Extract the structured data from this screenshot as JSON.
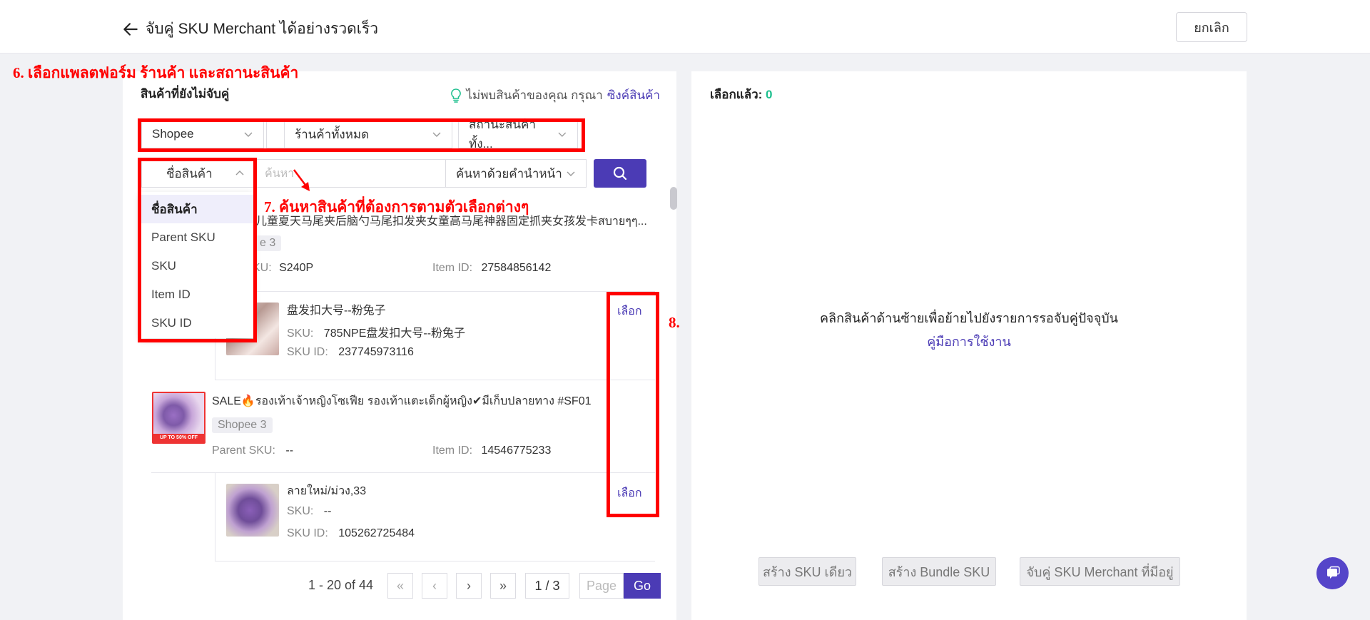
{
  "header": {
    "title": "จับคู่ SKU Merchant ได้อย่างรวดเร็ว",
    "cancel_label": "ยกเลิก"
  },
  "annotations": {
    "step6": "6. เลือกแพลตฟอร์ม ร้านค้า และสถานะสินค้า",
    "step7": "7. ค้นหาสินค้าที่ต้องการตามตัวเลือกต่างๆ",
    "step8": "8."
  },
  "left": {
    "title": "สินค้าที่ยังไม่จับคู่",
    "notfound_text": "ไม่พบสินค้าของคุณ กรุณา",
    "notfound_link": "ซิงค์สินค้า",
    "filters": {
      "platform": "Shopee",
      "shop": "ร้านค้าทั้งหมด",
      "status": "สถานะสินค้าทั้ง..."
    },
    "search": {
      "field": "ชื่อสินค้า",
      "placeholder": "ค้นหา",
      "mode": "ค้นหาด้วยคำนำหน้า"
    },
    "dropdown": [
      "ชื่อสินค้า",
      "Parent SKU",
      "SKU",
      "Item ID",
      "SKU ID"
    ],
    "sku_label": "SKU:",
    "sku_id_label": "SKU ID:",
    "parent_sku_label": "Parent SKU:",
    "item_id_label": "Item ID:",
    "pick_label": "เลือก",
    "product1": {
      "name": "儿童夏天马尾夹后脑勺马尾扣发夹女童高马尾神器固定抓夹女孩发卡สบายๆๆ...",
      "tag": "e 3",
      "sku_partial": "KU:",
      "sku": "S240P",
      "item_id": "27584856142"
    },
    "variant1": {
      "name": "盘发扣大号--粉兔子",
      "sku": "785NPE盘发扣大号--粉兔子",
      "sku_id": "237745973116"
    },
    "product2": {
      "name": "SALE🔥รองเท้าเจ้าหญิงโซเฟีย รองเท้าแตะเด็กผู้หญิง✔มีเก็บปลายทาง #SF01",
      "tag": "Shopee 3",
      "parent_sku": "--",
      "item_id": "14546775233",
      "thumb_badge": "UP TO 50% OFF"
    },
    "variant2": {
      "name": "ลายใหม่/ม่วง,33",
      "sku": "--",
      "sku_id": "105262725484"
    },
    "pager": {
      "range": "1 - 20 of 44",
      "page": "1 / 3",
      "page_placeholder": "Page",
      "go": "Go"
    }
  },
  "right": {
    "selected_label": "เลือกแล้ว:",
    "selected_count": "0",
    "empty_msg": "คลิกสินค้าด้านซ้ายเพื่อย้ายไปยังรายการรอจับคู่ปัจจุบัน",
    "manual_link": "คู่มือการใช้งาน",
    "buttons": {
      "single": "สร้าง SKU เดียว",
      "bundle": "สร้าง Bundle SKU",
      "existing": "จับคู่ SKU Merchant ที่มีอยู่"
    }
  },
  "colors": {
    "accent": "#4b3bb5",
    "annotation": "#ff0000",
    "count": "#1dbf8e"
  },
  "icons": [
    "back-arrow-icon",
    "bulb-icon",
    "chevron-down-icon",
    "chevron-up-icon",
    "search-icon",
    "chat-icon"
  ]
}
